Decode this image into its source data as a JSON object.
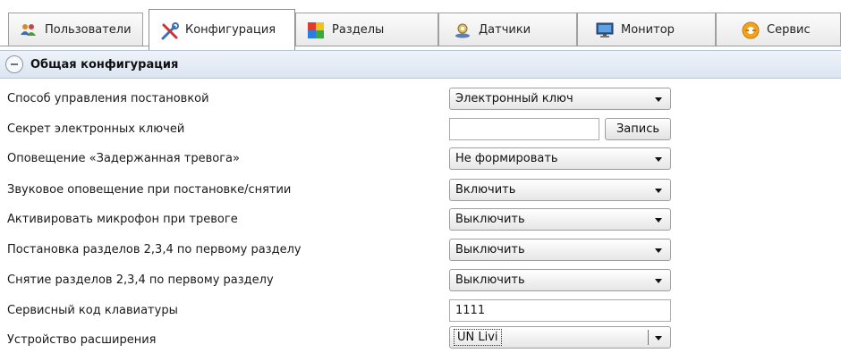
{
  "tabs": [
    {
      "label": "Пользователи",
      "icon": "users-icon",
      "active": false
    },
    {
      "label": "Конфигурация",
      "icon": "tools-icon",
      "active": true
    },
    {
      "label": "Разделы",
      "icon": "partitions-icon",
      "active": false
    },
    {
      "label": "Датчики",
      "icon": "sensor-icon",
      "active": false
    },
    {
      "label": "Монитор",
      "icon": "monitor-icon",
      "active": false
    },
    {
      "label": "Сервис",
      "icon": "service-icon",
      "active": false
    }
  ],
  "section": {
    "title": "Общая конфигурация",
    "icon": "collapse-icon"
  },
  "rows": [
    {
      "label": "Способ управления постановкой",
      "control": "select",
      "value": "Электронный ключ"
    },
    {
      "label": "Секрет электронных ключей",
      "control": "text+button",
      "value": "",
      "button": "Запись"
    },
    {
      "label": "Оповещение «Задержанная тревога»",
      "control": "select",
      "value": "Не формировать"
    },
    {
      "label": "Звуковое оповещение при постановке/снятии",
      "control": "select",
      "value": "Включить"
    },
    {
      "label": "Активировать микрофон при тревоге",
      "control": "select",
      "value": "Выключить"
    },
    {
      "label": "Постановка разделов 2,3,4 по первому разделу",
      "control": "select",
      "value": "Выключить"
    },
    {
      "label": "Снятие разделов 2,3,4 по первому разделу",
      "control": "select",
      "value": "Выключить"
    },
    {
      "label": "Сервисный код клавиатуры",
      "control": "text",
      "value": "1111"
    },
    {
      "label": "Устройство расширения",
      "control": "select",
      "value": "UN Livi",
      "focused": true
    }
  ],
  "colors": {
    "section_bg": "#dbe5f1",
    "tab_border": "#a0a0a0"
  }
}
